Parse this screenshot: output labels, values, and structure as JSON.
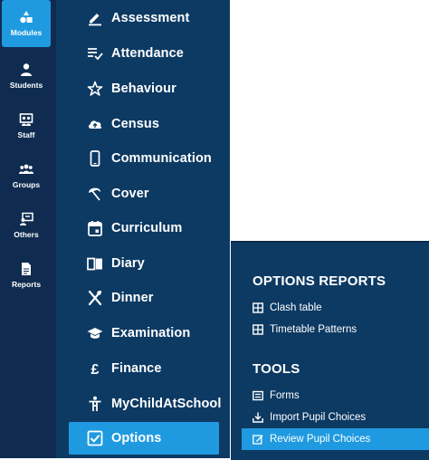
{
  "rail": {
    "items": [
      {
        "label": "Modules",
        "icon": "modules-icon",
        "active": true
      },
      {
        "label": "Students",
        "icon": "student-icon"
      },
      {
        "label": "Staff",
        "icon": "staff-icon"
      },
      {
        "label": "Groups",
        "icon": "groups-icon"
      },
      {
        "label": "Others",
        "icon": "others-icon"
      },
      {
        "label": "Reports",
        "icon": "reports-icon"
      }
    ]
  },
  "modules": {
    "items": [
      {
        "label": "Assessment",
        "icon": "pencil-icon"
      },
      {
        "label": "Attendance",
        "icon": "list-check-icon"
      },
      {
        "label": "Behaviour",
        "icon": "star-icon"
      },
      {
        "label": "Census",
        "icon": "cloud-upload-icon"
      },
      {
        "label": "Communication",
        "icon": "phone-icon"
      },
      {
        "label": "Cover",
        "icon": "umbrella-icon"
      },
      {
        "label": "Curriculum",
        "icon": "calendar-icon"
      },
      {
        "label": "Diary",
        "icon": "book-icon"
      },
      {
        "label": "Dinner",
        "icon": "cutlery-icon"
      },
      {
        "label": "Examination",
        "icon": "graduation-cap-icon"
      },
      {
        "label": "Finance",
        "icon": "pound-icon"
      },
      {
        "label": "MyChildAtSchool",
        "icon": "child-icon"
      },
      {
        "label": "Options",
        "icon": "checkbox-icon",
        "active": true
      }
    ]
  },
  "submenu": {
    "options_reports_heading": "OPTIONS REPORTS",
    "options_reports": [
      {
        "label": "Clash table",
        "icon": "table-icon"
      },
      {
        "label": "Timetable Patterns",
        "icon": "table-icon"
      }
    ],
    "tools_heading": "TOOLS",
    "tools": [
      {
        "label": "Forms",
        "icon": "form-icon"
      },
      {
        "label": "Import Pupil Choices",
        "icon": "import-icon"
      },
      {
        "label": "Review Pupil Choices",
        "icon": "edit-icon",
        "active": true
      }
    ]
  },
  "colors": {
    "rail_bg": "#0f2c50",
    "panel_bg": "#0d3a63",
    "accent": "#1f9ae0",
    "text": "#ffffff"
  }
}
